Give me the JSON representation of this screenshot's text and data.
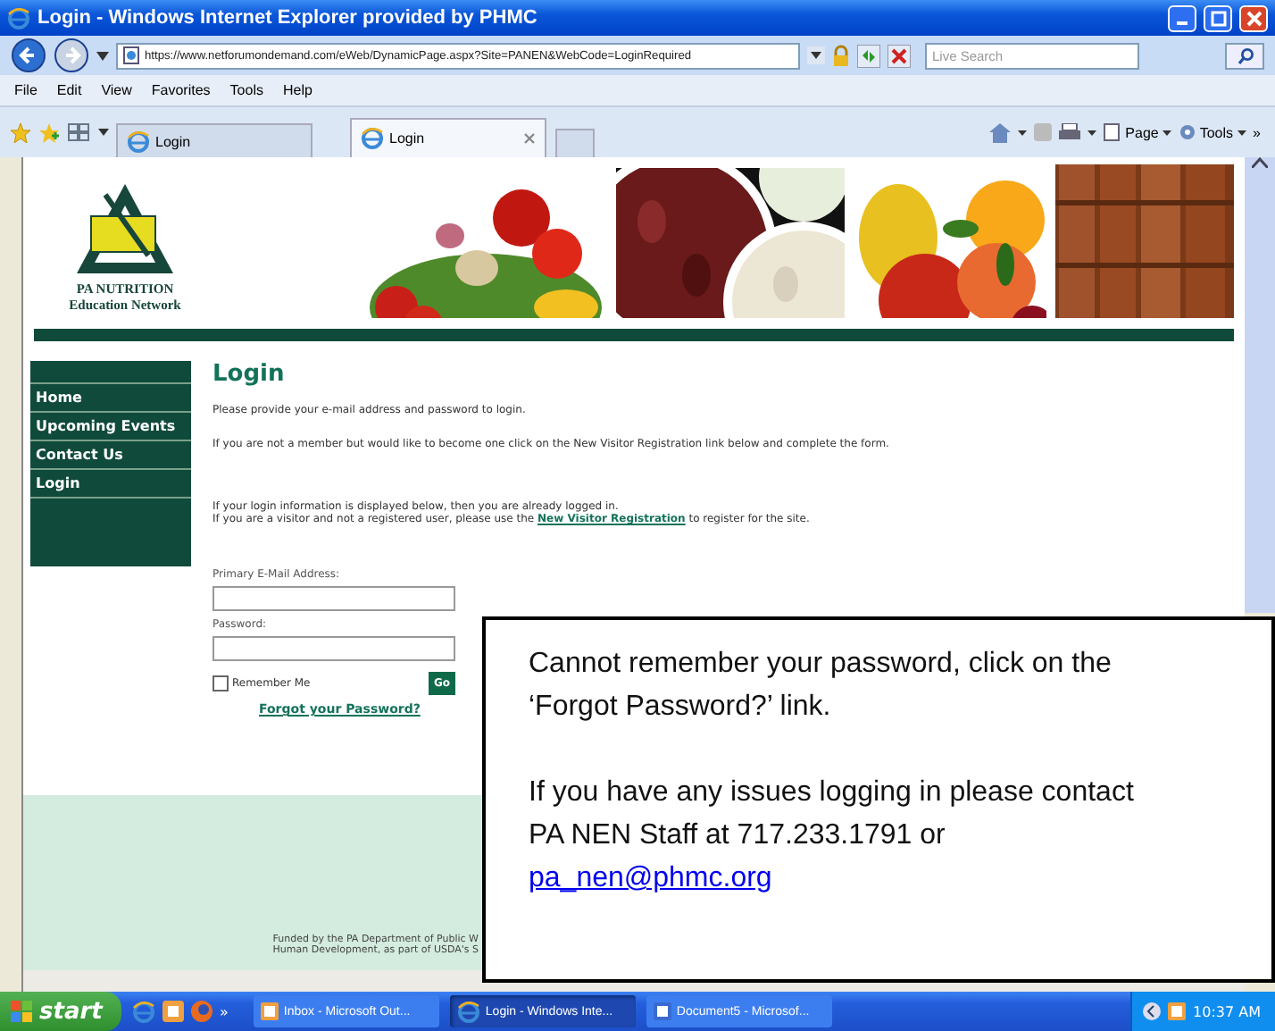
{
  "window": {
    "title": "Login - Windows Internet Explorer provided by PHMC"
  },
  "address_bar": {
    "url": "https://www.netforumondemand.com/eWeb/DynamicPage.aspx?Site=PANEN&WebCode=LoginRequired",
    "search_placeholder": "Live Search"
  },
  "menu": [
    "File",
    "Edit",
    "View",
    "Favorites",
    "Tools",
    "Help"
  ],
  "tabs": [
    {
      "label": "Login",
      "selected": false
    },
    {
      "label": "Login",
      "selected": true
    }
  ],
  "command_bar": [
    "Page",
    "Tools"
  ],
  "site": {
    "logo": [
      "PA NUTRITION",
      "Education Network"
    ],
    "nav": [
      "Home",
      "Upcoming Events",
      "Contact Us",
      "Login"
    ],
    "heading": "Login",
    "intro": "Please provide your e-mail address and password to login.",
    "member_note": "If you are not a member but would like to become one click on the New Visitor Registration link below and complete the form.",
    "logged_in_note": "If your login information is displayed below, then you are already logged in.",
    "visitor_note": "If you are a visitor and not a registered user, please use the ",
    "visitor_link": "New Visitor Registration",
    "visitor_note_end": " to register for the site.",
    "email_label": "Primary E-Mail Address:",
    "password_label": "Password:",
    "remember": {
      "label": "Remember Me",
      "checked": false
    },
    "go": "Go",
    "forgot": "Forgot your Password?",
    "footer": [
      "Funded by the PA Department of Public W",
      "Human Development, as part of USDA's S"
    ]
  },
  "callout": {
    "paragraphs": [
      [
        "Cannot remember your password, click on the",
        "‘Forgot Password?’ link."
      ],
      [
        "If you have any issues logging in please contact",
        "PA NEN Staff at 717.233.1791 or"
      ]
    ],
    "email": "pa_nen@phmc.org"
  },
  "taskbar": {
    "start": "start",
    "overflow": "»",
    "tasks": [
      {
        "label": "Inbox - Microsoft Out...",
        "selected": false
      },
      {
        "label": "Login - Windows Inte...",
        "selected": true
      },
      {
        "label": "Document5 - Microsof...",
        "selected": false
      }
    ],
    "clock": "10:37 AM"
  }
}
